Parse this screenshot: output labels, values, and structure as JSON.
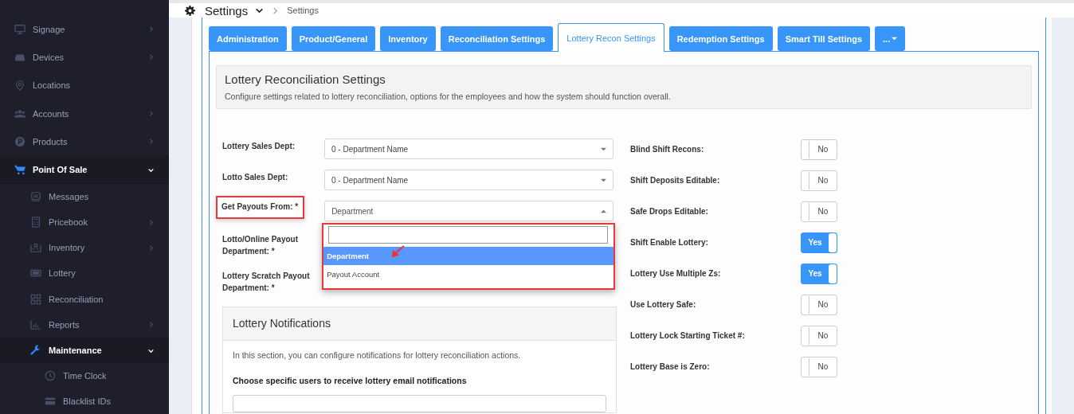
{
  "sidebar": {
    "items": [
      {
        "label": "Signage",
        "kind": "group",
        "expanded": false,
        "selected": false
      },
      {
        "label": "Devices",
        "kind": "group",
        "expanded": false,
        "selected": false
      },
      {
        "label": "Locations",
        "kind": "link",
        "selected": false
      },
      {
        "label": "Accounts",
        "kind": "group",
        "expanded": false,
        "selected": false
      },
      {
        "label": "Products",
        "kind": "group",
        "expanded": false,
        "selected": false
      },
      {
        "label": "Point Of Sale",
        "kind": "group",
        "expanded": true,
        "selected": true,
        "children": [
          {
            "label": "Messages",
            "kind": "link",
            "selected": false
          },
          {
            "label": "Pricebook",
            "kind": "group",
            "expanded": false,
            "selected": false
          },
          {
            "label": "Inventory",
            "kind": "group",
            "expanded": false,
            "selected": false
          },
          {
            "label": "Lottery",
            "kind": "link",
            "selected": false
          },
          {
            "label": "Reconciliation",
            "kind": "link",
            "selected": false
          },
          {
            "label": "Reports",
            "kind": "group",
            "expanded": false,
            "selected": false
          },
          {
            "label": "Maintenance",
            "kind": "group",
            "expanded": true,
            "selected": true,
            "children": [
              {
                "label": "Time Clock",
                "selected": false
              },
              {
                "label": "Blacklist IDs",
                "selected": false
              }
            ]
          }
        ]
      }
    ]
  },
  "header": {
    "title": "Settings",
    "breadcrumb": "Settings"
  },
  "tabs": [
    {
      "label": "Administration",
      "selected": false
    },
    {
      "label": "Product/General",
      "selected": false
    },
    {
      "label": "Inventory",
      "selected": false
    },
    {
      "label": "Reconciliation Settings",
      "selected": false
    },
    {
      "label": "Lottery Recon Settings",
      "selected": true
    },
    {
      "label": "Redemption Settings",
      "selected": false
    },
    {
      "label": "Smart Till Settings",
      "selected": false
    },
    {
      "label": "...",
      "selected": false
    }
  ],
  "section": {
    "title": "Lottery Reconciliation Settings",
    "description": "Configure settings related to lottery reconciliation, options for the employees and how the system should function overall."
  },
  "left_fields": [
    {
      "label": "Lottery Sales Dept:",
      "value": "0 - Department Name",
      "open": false,
      "highlighted": false
    },
    {
      "label": "Lotto Sales Dept:",
      "value": "0 - Department Name",
      "open": false,
      "highlighted": false
    },
    {
      "label": "Get Payouts From: *",
      "value": "Department",
      "open": true,
      "highlighted": true,
      "options": [
        {
          "label": "Department",
          "selected": true
        },
        {
          "label": "Payout Account",
          "selected": false
        }
      ]
    },
    {
      "label": "Lotto/Online Payout Department: *",
      "highlighted": false
    },
    {
      "label": "Lottery Scratch Payout Department: *",
      "highlighted": false
    }
  ],
  "toggles": [
    {
      "label": "Blind Shift Recons:",
      "on": false,
      "value": "No"
    },
    {
      "label": "Shift Deposits Editable:",
      "on": false,
      "value": "No"
    },
    {
      "label": "Safe Drops Editable:",
      "on": false,
      "value": "No"
    },
    {
      "label": "Shift Enable Lottery:",
      "on": true,
      "value": "Yes"
    },
    {
      "label": "Lottery Use Multiple Zs:",
      "on": true,
      "value": "Yes"
    },
    {
      "label": "Use Lottery Safe:",
      "on": false,
      "value": "No"
    },
    {
      "label": "Lottery Lock Starting Ticket #:",
      "on": false,
      "value": "No"
    },
    {
      "label": "Lottery Base is Zero:",
      "on": false,
      "value": "No"
    }
  ],
  "notifications": {
    "title": "Lottery Notifications",
    "description": "In this section, you can configure notifications for lottery reconciliation actions.",
    "users_label": "Choose specific users to receive lottery email notifications"
  }
}
